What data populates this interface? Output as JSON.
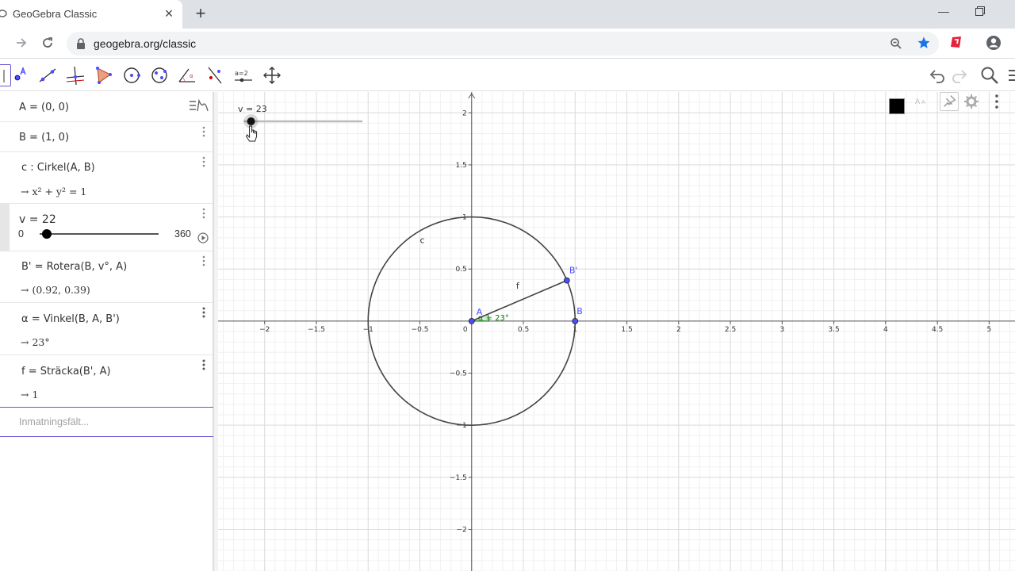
{
  "browser": {
    "tab_title": "GeoGebra Classic",
    "tab_close": "×",
    "new_tab": "+",
    "minimize": "—",
    "url": "geogebra.org/classic"
  },
  "colors": {
    "accent": "#6557d2",
    "point": "#4d4dff",
    "angle": "#007f00",
    "grid_major": "#dcdcdc",
    "grid_minor": "#f0f0f0"
  },
  "toolbar": {
    "tools": [
      "move-tool-icon",
      "point-tool-icon",
      "line-tool-icon",
      "perpendicular-tool-icon",
      "polygon-tool-icon",
      "circle-tool-icon",
      "ellipse-tool-icon",
      "angle-tool-icon",
      "reflect-tool-icon",
      "slider-tool-icon",
      "move-graphics-tool-icon"
    ],
    "slider_tool_label": "a=2"
  },
  "algebra": {
    "rows": [
      {
        "def": "A = (0, 0)",
        "out": ""
      },
      {
        "def": "B = (1, 0)",
        "out": ""
      },
      {
        "def": "c : Cirkel(A, B)",
        "out": "→  x² + y² = 1"
      },
      {
        "def": "v = 22",
        "out": ""
      },
      {
        "def": "B' = Rotera(B, v°, A)",
        "out": "→  (0.92, 0.39)"
      },
      {
        "def": "α = Vinkel(B, A, B')",
        "out": "→  23°"
      },
      {
        "def": "f = Sträcka(B', A)",
        "out": "→  1"
      }
    ],
    "slider": {
      "min": "0",
      "max": "360",
      "value": 22
    },
    "input_placeholder": "Inmatningsfält..."
  },
  "graphics": {
    "slider_label": "v = 23",
    "slider_value": 23,
    "slider_range": [
      0,
      360
    ],
    "axes": {
      "x_ticks": [
        "−2",
        "−1.5",
        "−1",
        "−0.5",
        "0",
        "0.5",
        "1",
        "1.5",
        "2",
        "2.5",
        "3",
        "3.5",
        "4",
        "4.5",
        "5"
      ],
      "y_ticks": [
        "2",
        "1.5",
        "1",
        "0.5",
        "−0.5",
        "−1",
        "−1.5",
        "−2"
      ],
      "x_range": [
        -2.45,
        5.25
      ],
      "y_range": [
        -2.4,
        2.2
      ]
    },
    "objects": {
      "circle_label": "c",
      "segment_label": "f",
      "point_A_label": "A",
      "point_B_label": "B",
      "point_B2_label": "B'",
      "angle_label": "α = 23°",
      "A": [
        0,
        0
      ],
      "B": [
        1,
        0
      ],
      "B2": [
        0.92,
        0.39
      ],
      "circle_radius": 1
    }
  }
}
